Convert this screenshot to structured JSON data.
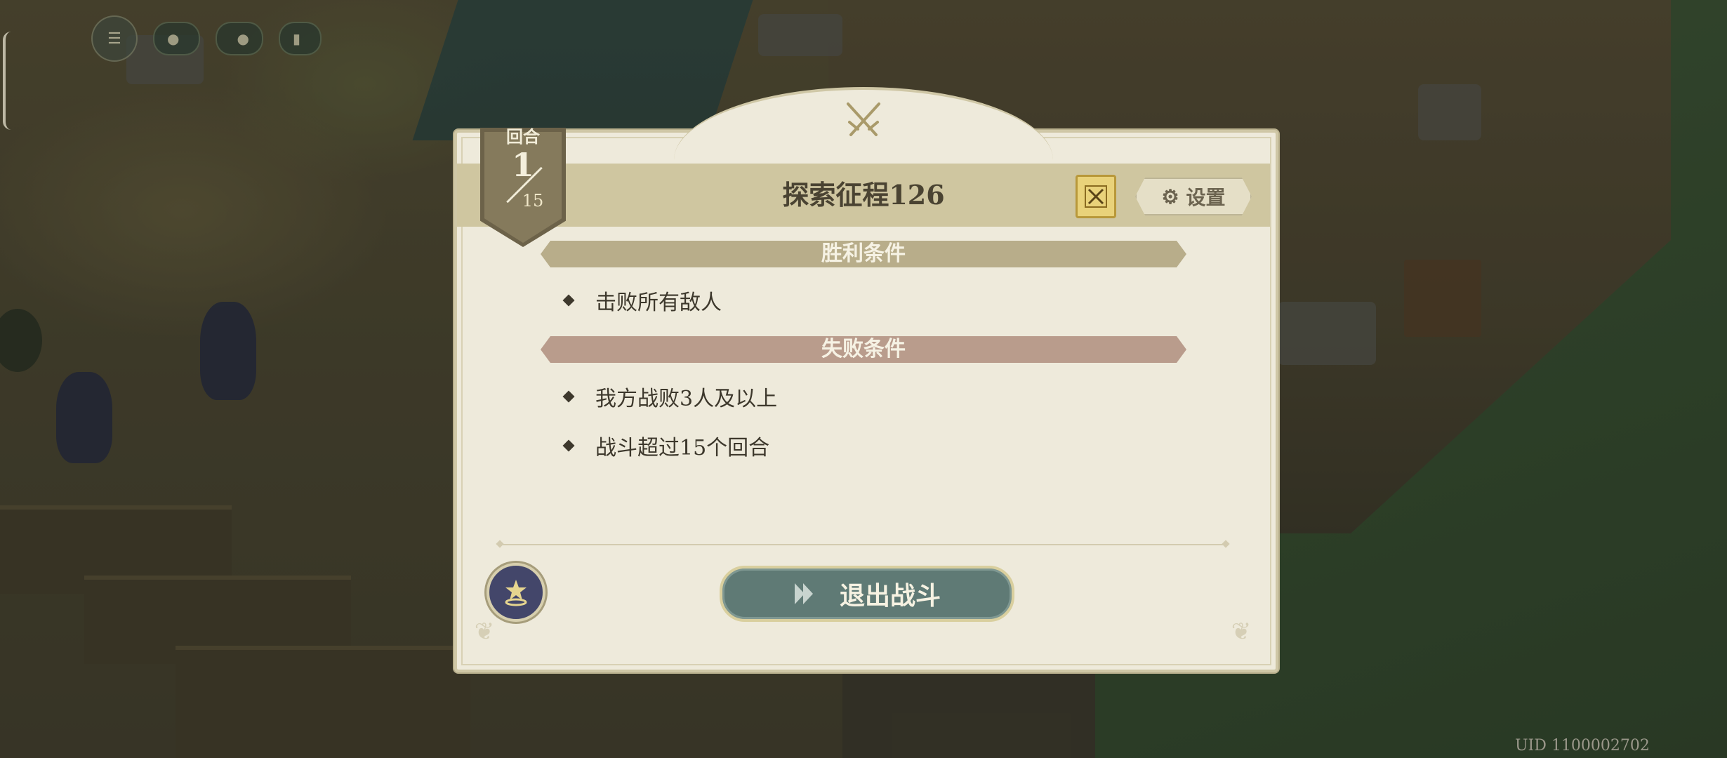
{
  "hud": {
    "menu_icon": "menu-icon",
    "pill1_label": "",
    "pill2_label": "",
    "pill3_label": ""
  },
  "dialog": {
    "title": "探索征程126",
    "settings_label": "设置",
    "round": {
      "label": "回合",
      "current": "1",
      "max": "15"
    },
    "win_header": "胜利条件",
    "win_conditions": [
      "击败所有敌人"
    ],
    "lose_header": "失败条件",
    "lose_conditions": [
      "我方战败3人及以上",
      "战斗超过15个回合"
    ],
    "exit_label": "退出战斗"
  },
  "uid": "UID 1100002702",
  "colors": {
    "win_bar": "#b8ad8a",
    "lose_bar": "#b99c8c",
    "exit_button": "#5f7a75",
    "panel_bg": "#eeeadb"
  }
}
